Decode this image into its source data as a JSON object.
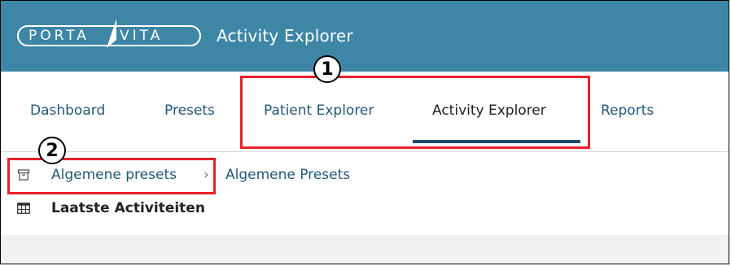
{
  "header": {
    "logo_left": "PORTA",
    "logo_right": "VITA",
    "app_title": "Activity Explorer"
  },
  "nav": {
    "items": [
      {
        "label": "Dashboard"
      },
      {
        "label": "Presets"
      },
      {
        "label": "Patient Explorer"
      },
      {
        "label": "Activity Explorer",
        "active": true
      },
      {
        "label": "Reports"
      }
    ]
  },
  "breadcrumb": {
    "items": [
      {
        "label": "Algemene presets"
      },
      {
        "label": "Algemene Presets"
      }
    ],
    "separator": "›"
  },
  "section": {
    "title": "Laatste Activiteiten"
  },
  "annotations": [
    {
      "number": "1"
    },
    {
      "number": "2"
    }
  ],
  "colors": {
    "header_bg": "#3e86a6",
    "link": "#23587a",
    "active_underline": "#1d4d6b",
    "highlight": "#e8202a"
  },
  "icons": {
    "breadcrumb": "archive-box-icon",
    "section": "table-grid-icon"
  }
}
